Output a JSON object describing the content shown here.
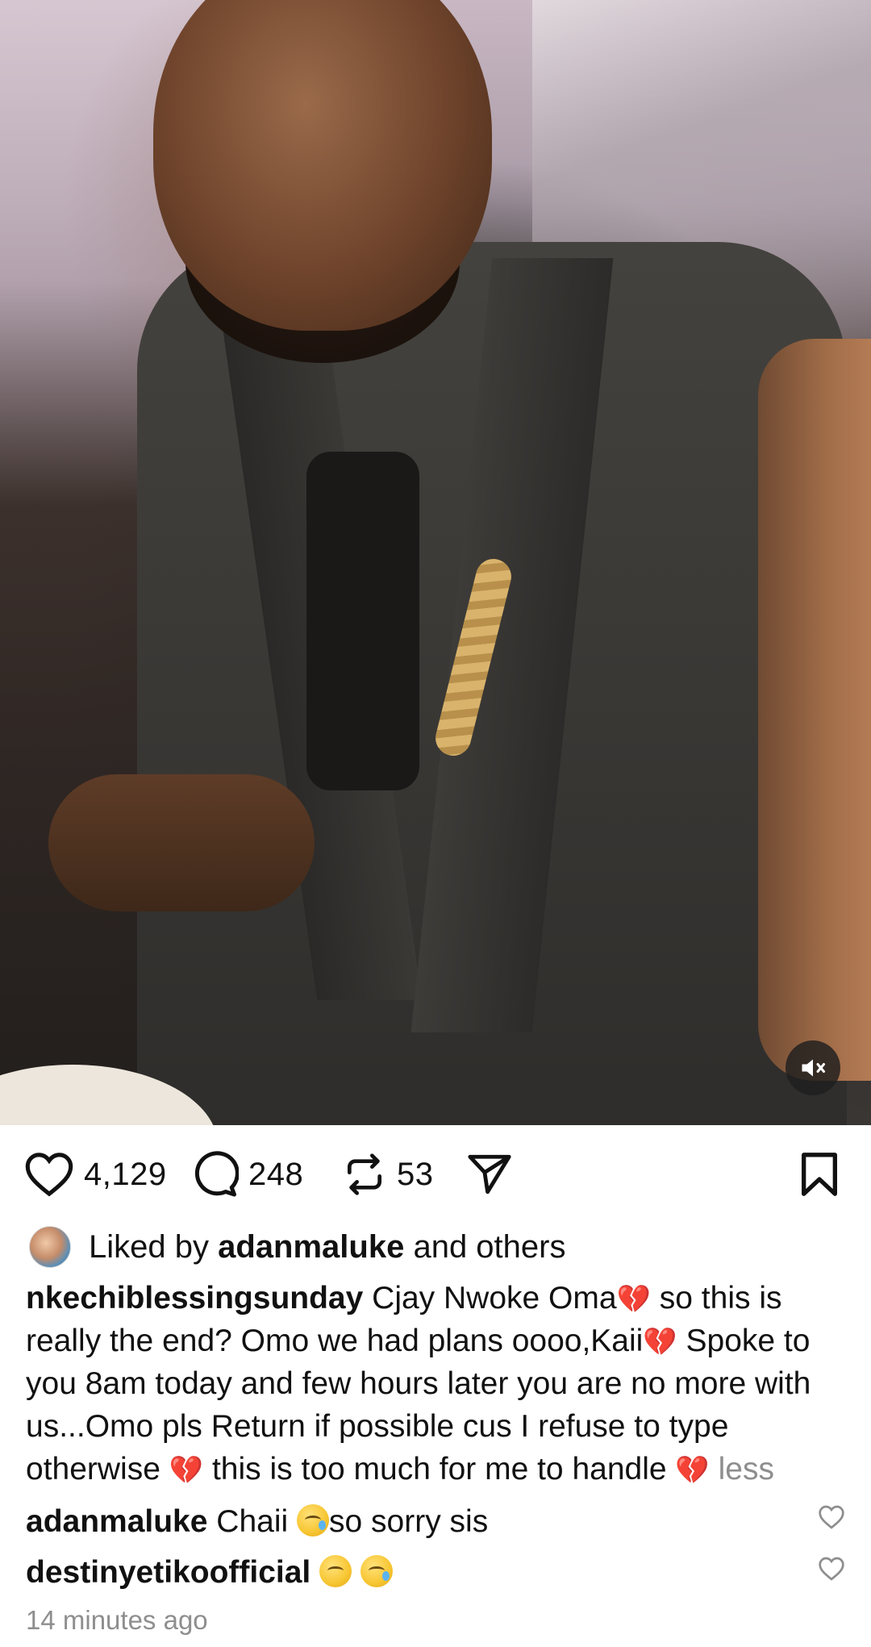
{
  "post": {
    "media_muted": true
  },
  "actions": {
    "likes_count": "4,129",
    "comments_count": "248",
    "reposts_count": "53"
  },
  "liked_by": {
    "prefix": "Liked by",
    "user": "adanmaluke",
    "suffix": "and others"
  },
  "caption": {
    "username": "nkechiblessingsunday",
    "part1": "Cjay Nwoke Oma",
    "part2": "so this is really the end? Omo we had plans oooo,Kaii",
    "part3": "Spoke to you 8am today and few hours later you are no more with us...Omo pls Return if possible cus I refuse to type otherwise",
    "part4": "this is too much for me to handle",
    "more_label": "less",
    "heart_emoji": "💔"
  },
  "comments": [
    {
      "username": "adanmaluke",
      "text": "Chaii",
      "text_after": "so sorry sis"
    },
    {
      "username": "destinyetikoofficial",
      "text": ""
    }
  ],
  "timestamp": "14 minutes ago",
  "icons": {
    "like": "heart-icon",
    "comment": "comment-bubble-icon",
    "repost": "repost-icon",
    "share": "send-icon",
    "save": "bookmark-icon",
    "mute": "speaker-muted-icon"
  }
}
